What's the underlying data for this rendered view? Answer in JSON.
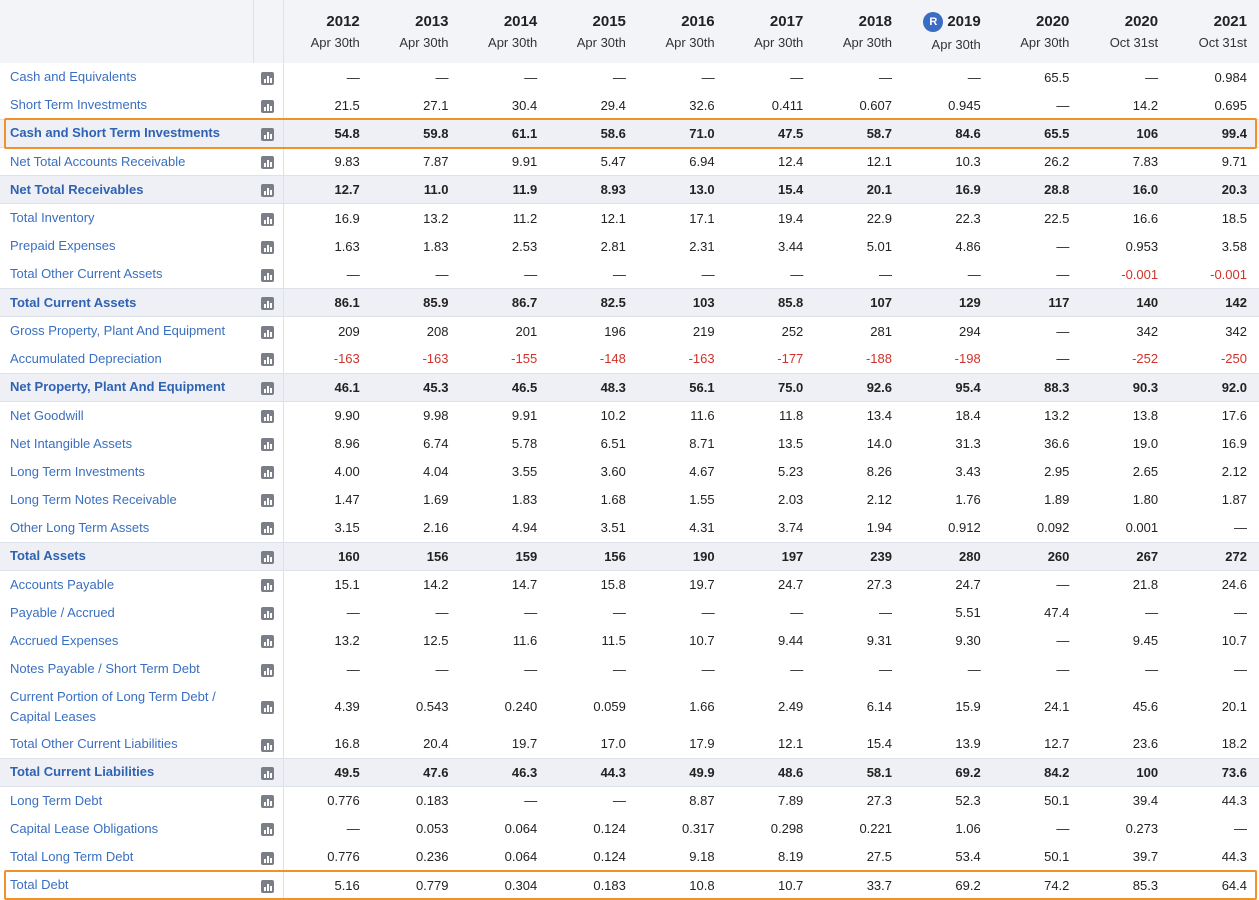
{
  "columns": [
    {
      "year": "2012",
      "date": "Apr 30th",
      "badge": ""
    },
    {
      "year": "2013",
      "date": "Apr 30th",
      "badge": ""
    },
    {
      "year": "2014",
      "date": "Apr 30th",
      "badge": ""
    },
    {
      "year": "2015",
      "date": "Apr 30th",
      "badge": ""
    },
    {
      "year": "2016",
      "date": "Apr 30th",
      "badge": ""
    },
    {
      "year": "2017",
      "date": "Apr 30th",
      "badge": ""
    },
    {
      "year": "2018",
      "date": "Apr 30th",
      "badge": ""
    },
    {
      "year": "2019",
      "date": "Apr 30th",
      "badge": "R"
    },
    {
      "year": "2020",
      "date": "Apr 30th",
      "badge": ""
    },
    {
      "year": "2020",
      "date": "Oct 31st",
      "badge": ""
    },
    {
      "year": "2021",
      "date": "Oct 31st",
      "badge": ""
    }
  ],
  "rows": [
    {
      "label": "Cash and Equivalents",
      "total": false,
      "values": [
        "—",
        "—",
        "—",
        "—",
        "—",
        "—",
        "—",
        "—",
        "65.5",
        "—",
        "0.984"
      ]
    },
    {
      "label": "Short Term Investments",
      "total": false,
      "values": [
        "21.5",
        "27.1",
        "30.4",
        "29.4",
        "32.6",
        "0.411",
        "0.607",
        "0.945",
        "—",
        "14.2",
        "0.695"
      ]
    },
    {
      "label": "Cash and Short Term Investments",
      "total": true,
      "highlight": true,
      "values": [
        "54.8",
        "59.8",
        "61.1",
        "58.6",
        "71.0",
        "47.5",
        "58.7",
        "84.6",
        "65.5",
        "106",
        "99.4"
      ]
    },
    {
      "label": "Net Total Accounts Receivable",
      "total": false,
      "values": [
        "9.83",
        "7.87",
        "9.91",
        "5.47",
        "6.94",
        "12.4",
        "12.1",
        "10.3",
        "26.2",
        "7.83",
        "9.71"
      ]
    },
    {
      "label": "Net Total Receivables",
      "total": true,
      "values": [
        "12.7",
        "11.0",
        "11.9",
        "8.93",
        "13.0",
        "15.4",
        "20.1",
        "16.9",
        "28.8",
        "16.0",
        "20.3"
      ]
    },
    {
      "label": "Total Inventory",
      "total": false,
      "values": [
        "16.9",
        "13.2",
        "11.2",
        "12.1",
        "17.1",
        "19.4",
        "22.9",
        "22.3",
        "22.5",
        "16.6",
        "18.5"
      ]
    },
    {
      "label": "Prepaid Expenses",
      "total": false,
      "values": [
        "1.63",
        "1.83",
        "2.53",
        "2.81",
        "2.31",
        "3.44",
        "5.01",
        "4.86",
        "—",
        "0.953",
        "3.58"
      ]
    },
    {
      "label": "Total Other Current Assets",
      "total": false,
      "values": [
        "—",
        "—",
        "—",
        "—",
        "—",
        "—",
        "—",
        "—",
        "—",
        "-0.001",
        "-0.001"
      ]
    },
    {
      "label": "Total Current Assets",
      "total": true,
      "values": [
        "86.1",
        "85.9",
        "86.7",
        "82.5",
        "103",
        "85.8",
        "107",
        "129",
        "117",
        "140",
        "142"
      ]
    },
    {
      "label": "Gross Property, Plant And Equipment",
      "total": false,
      "values": [
        "209",
        "208",
        "201",
        "196",
        "219",
        "252",
        "281",
        "294",
        "—",
        "342",
        "342"
      ]
    },
    {
      "label": "Accumulated Depreciation",
      "total": false,
      "values": [
        "-163",
        "-163",
        "-155",
        "-148",
        "-163",
        "-177",
        "-188",
        "-198",
        "—",
        "-252",
        "-250"
      ]
    },
    {
      "label": "Net Property, Plant And Equipment",
      "total": true,
      "values": [
        "46.1",
        "45.3",
        "46.5",
        "48.3",
        "56.1",
        "75.0",
        "92.6",
        "95.4",
        "88.3",
        "90.3",
        "92.0"
      ]
    },
    {
      "label": "Net Goodwill",
      "total": false,
      "values": [
        "9.90",
        "9.98",
        "9.91",
        "10.2",
        "11.6",
        "11.8",
        "13.4",
        "18.4",
        "13.2",
        "13.8",
        "17.6"
      ]
    },
    {
      "label": "Net Intangible Assets",
      "total": false,
      "values": [
        "8.96",
        "6.74",
        "5.78",
        "6.51",
        "8.71",
        "13.5",
        "14.0",
        "31.3",
        "36.6",
        "19.0",
        "16.9"
      ]
    },
    {
      "label": "Long Term Investments",
      "total": false,
      "values": [
        "4.00",
        "4.04",
        "3.55",
        "3.60",
        "4.67",
        "5.23",
        "8.26",
        "3.43",
        "2.95",
        "2.65",
        "2.12"
      ]
    },
    {
      "label": "Long Term Notes Receivable",
      "total": false,
      "values": [
        "1.47",
        "1.69",
        "1.83",
        "1.68",
        "1.55",
        "2.03",
        "2.12",
        "1.76",
        "1.89",
        "1.80",
        "1.87"
      ]
    },
    {
      "label": "Other Long Term Assets",
      "total": false,
      "values": [
        "3.15",
        "2.16",
        "4.94",
        "3.51",
        "4.31",
        "3.74",
        "1.94",
        "0.912",
        "0.092",
        "0.001",
        "—"
      ]
    },
    {
      "label": "Total Assets",
      "total": true,
      "values": [
        "160",
        "156",
        "159",
        "156",
        "190",
        "197",
        "239",
        "280",
        "260",
        "267",
        "272"
      ]
    },
    {
      "label": "Accounts Payable",
      "total": false,
      "values": [
        "15.1",
        "14.2",
        "14.7",
        "15.8",
        "19.7",
        "24.7",
        "27.3",
        "24.7",
        "—",
        "21.8",
        "24.6"
      ]
    },
    {
      "label": "Payable / Accrued",
      "total": false,
      "values": [
        "—",
        "—",
        "—",
        "—",
        "—",
        "—",
        "—",
        "5.51",
        "47.4",
        "—",
        "—"
      ]
    },
    {
      "label": "Accrued Expenses",
      "total": false,
      "values": [
        "13.2",
        "12.5",
        "11.6",
        "11.5",
        "10.7",
        "9.44",
        "9.31",
        "9.30",
        "—",
        "9.45",
        "10.7"
      ]
    },
    {
      "label": "Notes Payable / Short Term Debt",
      "total": false,
      "values": [
        "—",
        "—",
        "—",
        "—",
        "—",
        "—",
        "—",
        "—",
        "—",
        "—",
        "—"
      ]
    },
    {
      "label": "Current Portion of Long Term Debt / Capital Leases",
      "total": false,
      "tall": true,
      "values": [
        "4.39",
        "0.543",
        "0.240",
        "0.059",
        "1.66",
        "2.49",
        "6.14",
        "15.9",
        "24.1",
        "45.6",
        "20.1"
      ]
    },
    {
      "label": "Total Other Current Liabilities",
      "total": false,
      "values": [
        "16.8",
        "20.4",
        "19.7",
        "17.0",
        "17.9",
        "12.1",
        "15.4",
        "13.9",
        "12.7",
        "23.6",
        "18.2"
      ]
    },
    {
      "label": "Total Current Liabilities",
      "total": true,
      "values": [
        "49.5",
        "47.6",
        "46.3",
        "44.3",
        "49.9",
        "48.6",
        "58.1",
        "69.2",
        "84.2",
        "100",
        "73.6"
      ]
    },
    {
      "label": "Long Term Debt",
      "total": false,
      "values": [
        "0.776",
        "0.183",
        "—",
        "—",
        "8.87",
        "7.89",
        "27.3",
        "52.3",
        "50.1",
        "39.4",
        "44.3"
      ]
    },
    {
      "label": "Capital Lease Obligations",
      "total": false,
      "values": [
        "—",
        "0.053",
        "0.064",
        "0.124",
        "0.317",
        "0.298",
        "0.221",
        "1.06",
        "—",
        "0.273",
        "—"
      ]
    },
    {
      "label": "Total Long Term Debt",
      "total": false,
      "values": [
        "0.776",
        "0.236",
        "0.064",
        "0.124",
        "9.18",
        "8.19",
        "27.5",
        "53.4",
        "50.1",
        "39.7",
        "44.3"
      ]
    },
    {
      "label": "Total Debt",
      "total": false,
      "highlight": true,
      "values": [
        "5.16",
        "0.779",
        "0.304",
        "0.183",
        "10.8",
        "10.7",
        "33.7",
        "69.2",
        "74.2",
        "85.3",
        "64.4"
      ]
    }
  ],
  "colors": {
    "accent": "#3a6fbf",
    "negative": "#d0322b",
    "highlight": "#f0922a",
    "total_row_bg": "#eef0f5"
  }
}
